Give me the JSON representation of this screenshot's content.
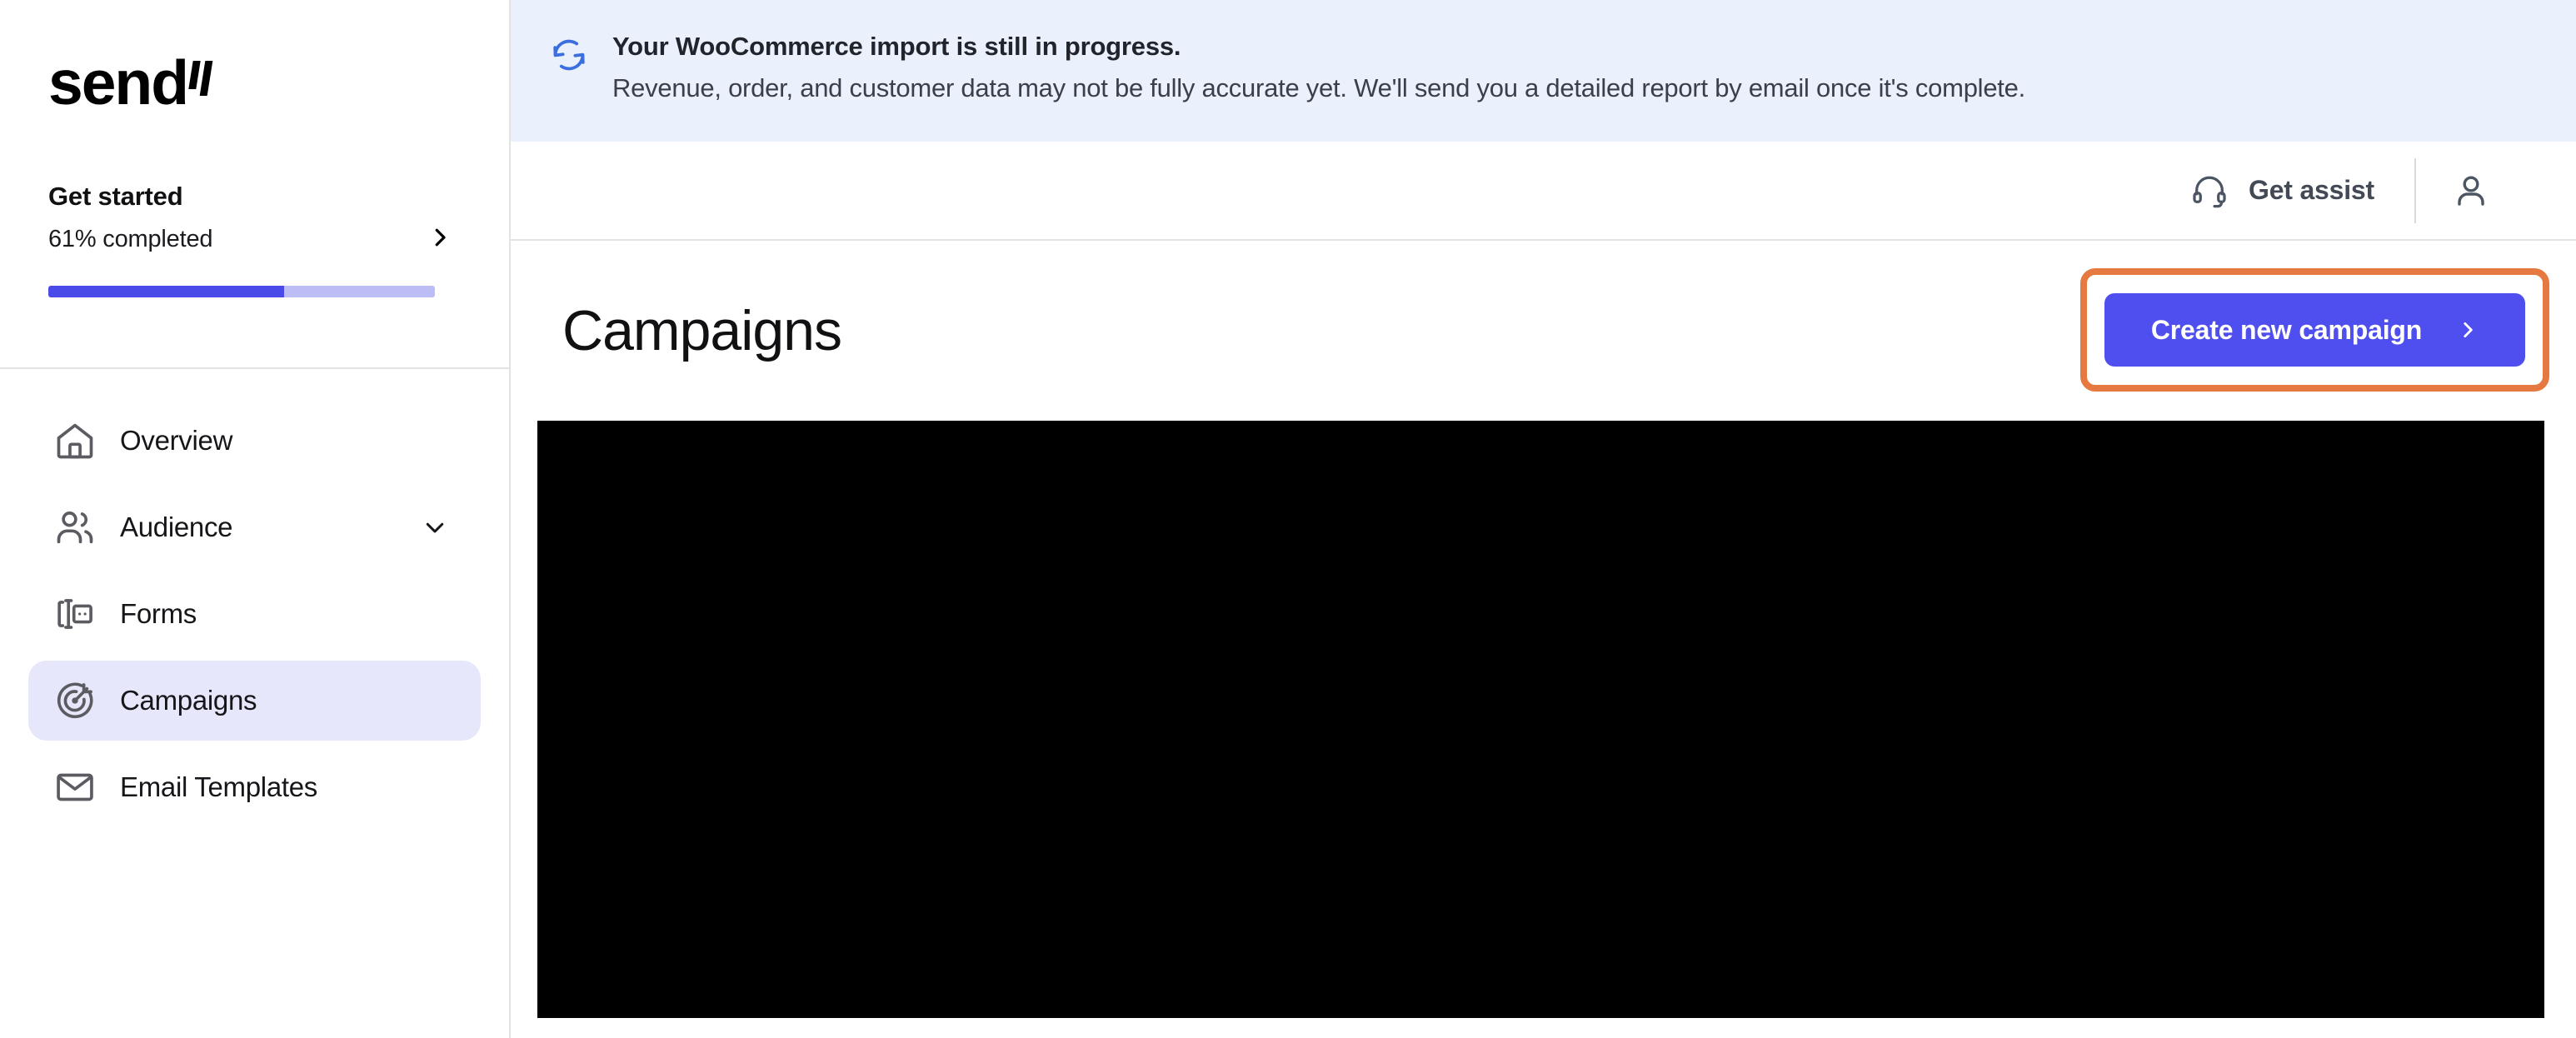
{
  "brand": {
    "name": "send",
    "logo_icon": "send-logo"
  },
  "sidebar": {
    "get_started": {
      "title": "Get started",
      "progress_label": "61% completed",
      "progress_percent": 61,
      "chevron_icon": "chevron-right-icon",
      "fill_color": "#4a4ae8",
      "track_color": "#bdbdf6"
    },
    "items": [
      {
        "label": "Overview",
        "icon": "home-icon",
        "active": false,
        "caret": false
      },
      {
        "label": "Audience",
        "icon": "users-icon",
        "active": false,
        "caret": true
      },
      {
        "label": "Forms",
        "icon": "form-icon",
        "active": false,
        "caret": false
      },
      {
        "label": "Campaigns",
        "icon": "target-icon",
        "active": true,
        "caret": false
      },
      {
        "label": "Email Templates",
        "icon": "envelope-icon",
        "active": false,
        "caret": false
      }
    ],
    "active_bg": "#e7e7fb"
  },
  "banner": {
    "icon": "sync-refresh-icon",
    "title": "Your WooCommerce import is still in progress.",
    "body": "Revenue, order, and customer data may not be fully accurate yet. We'll send you a detailed report by email once it's complete.",
    "bg_color": "#eaf0fc",
    "icon_color": "#3b6fe0"
  },
  "topbar": {
    "assist_label": "Get assist",
    "assist_icon": "headset-icon",
    "avatar_icon": "user-icon"
  },
  "page": {
    "title": "Campaigns",
    "cta": {
      "label": "Create new campaign",
      "chevron_icon": "chevron-right-icon",
      "bg_color": "#4f4ff0",
      "highlight_color": "#e5793f"
    }
  },
  "content": {
    "placeholder_color": "#000000"
  }
}
